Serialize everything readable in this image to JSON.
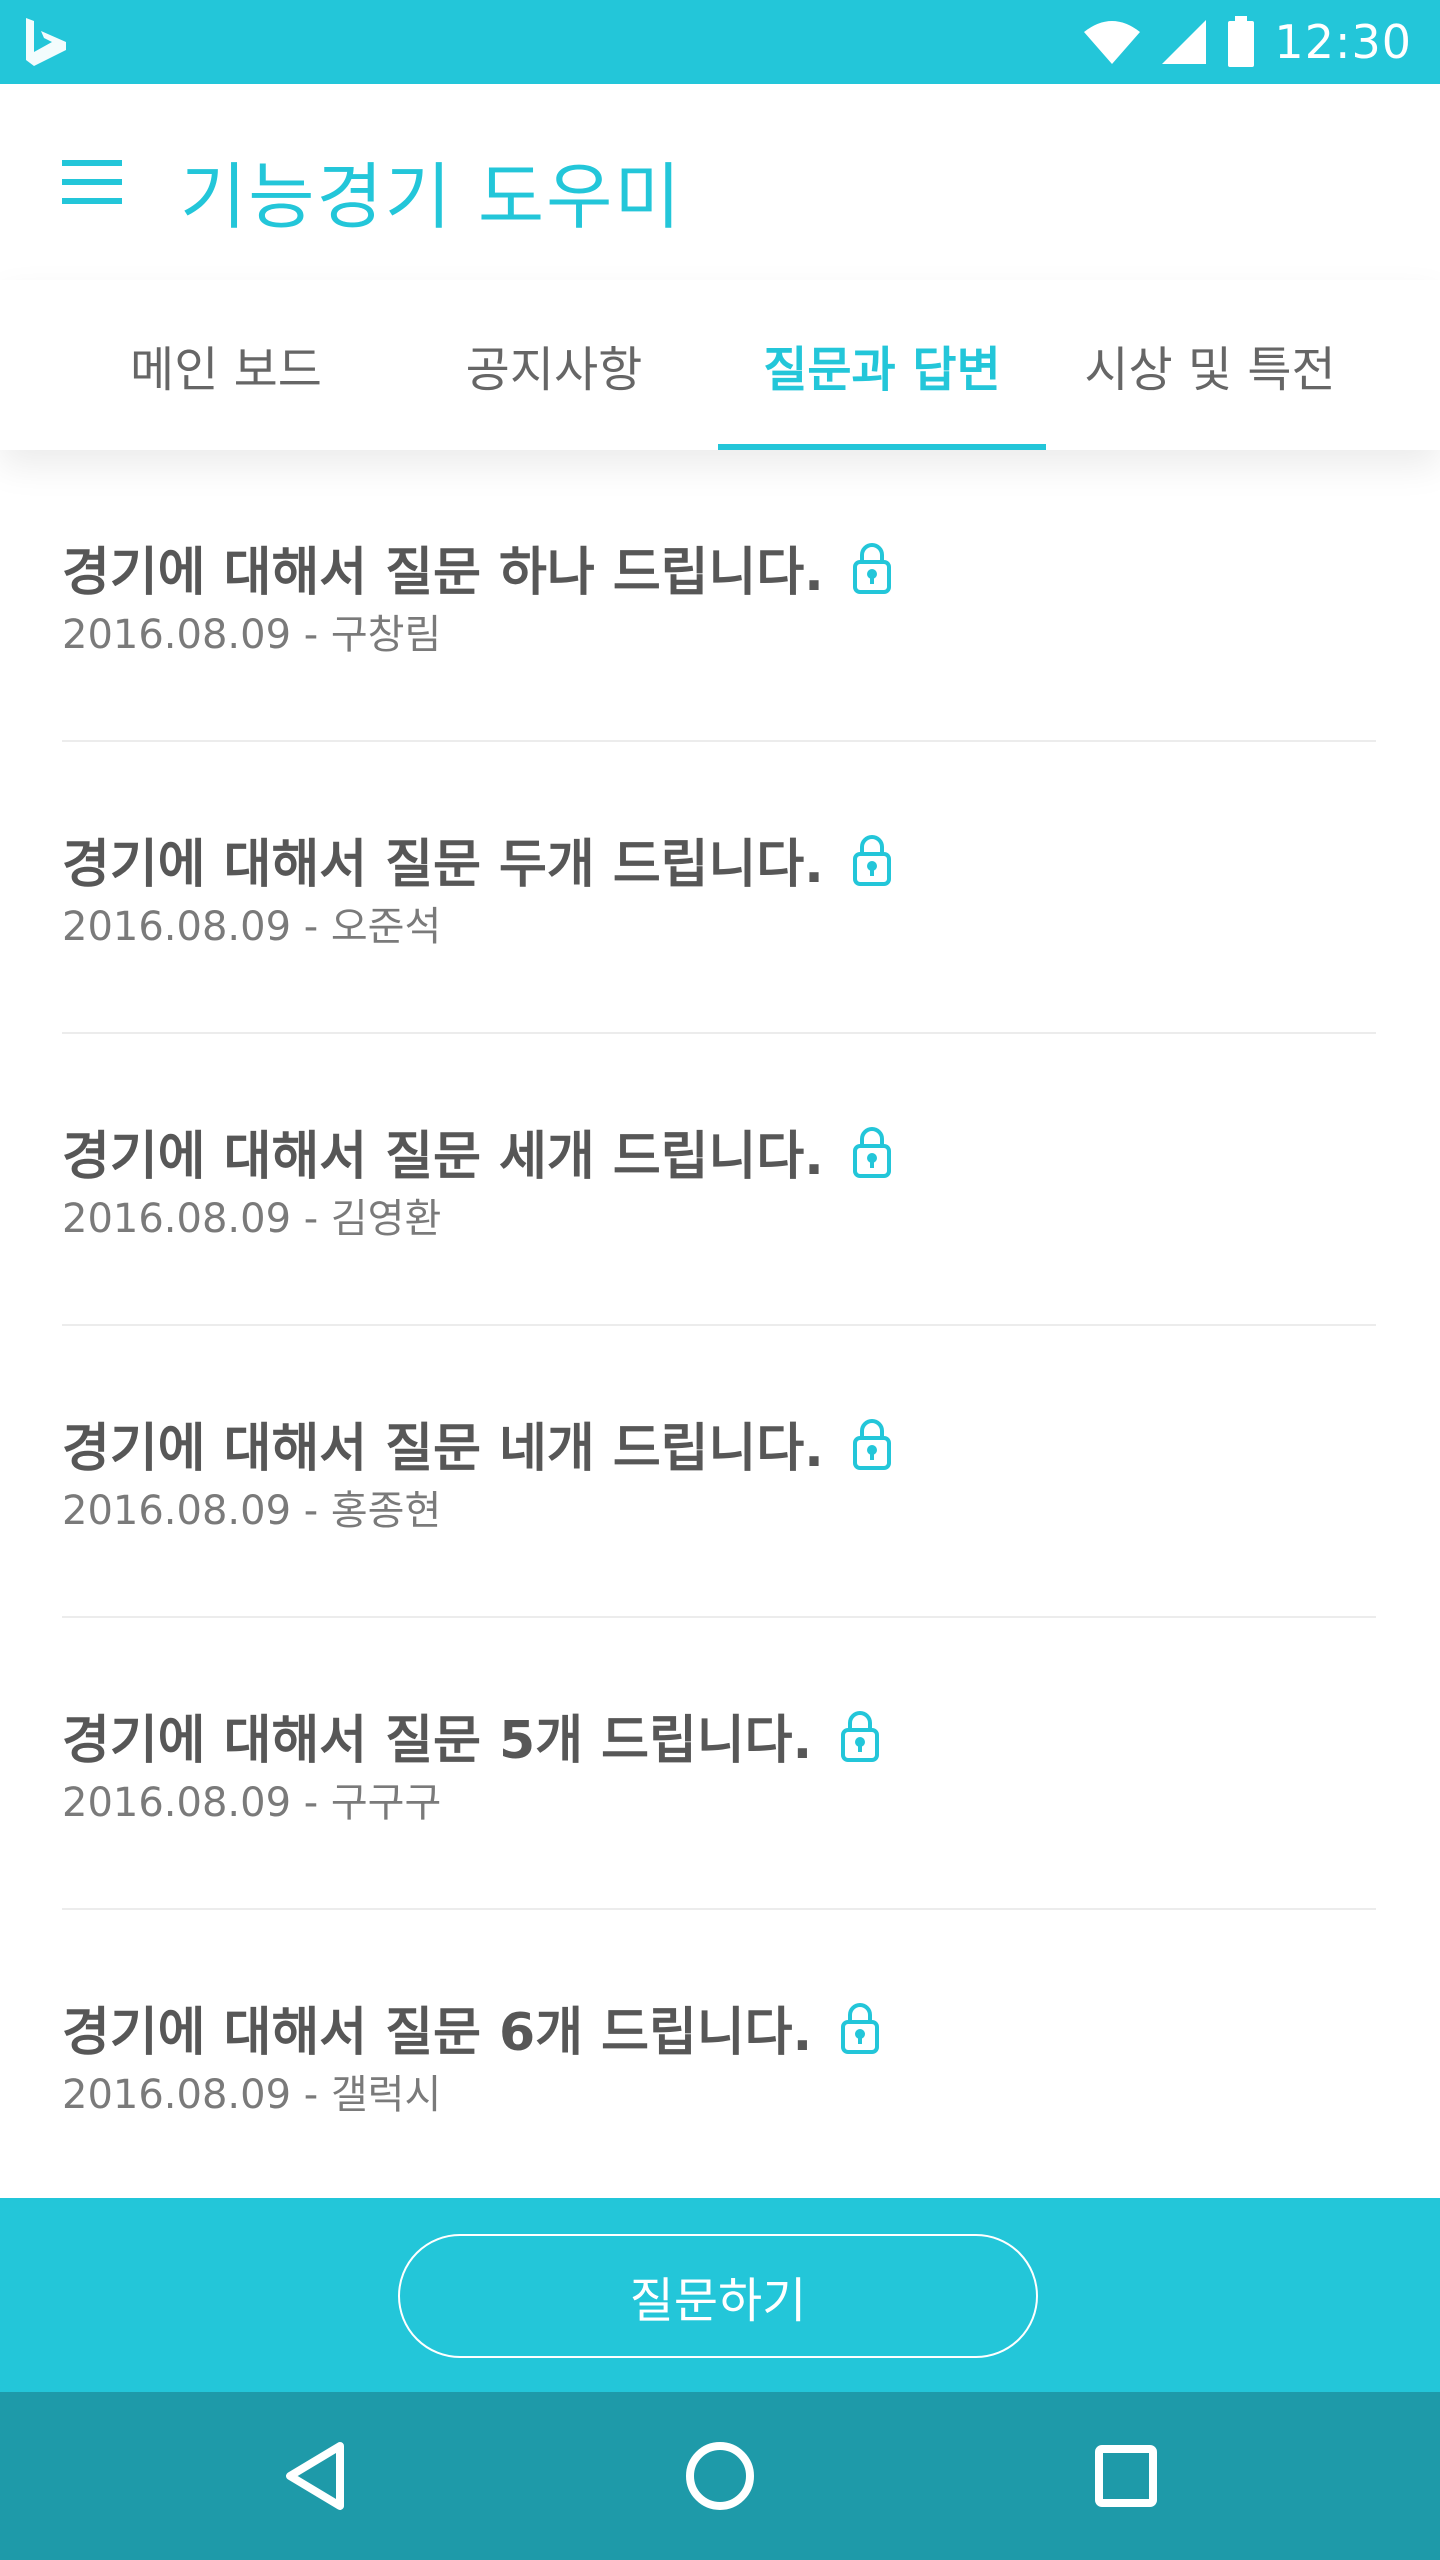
{
  "status_bar": {
    "time": "12:30",
    "icons": [
      "bing-logo-icon",
      "wifi-icon",
      "signal-icon",
      "battery-icon"
    ]
  },
  "app_bar": {
    "title": "기능경기 도우미",
    "menu_icon": "hamburger-menu-icon"
  },
  "tabs": [
    {
      "label": "메인 보드",
      "active": false
    },
    {
      "label": "공지사항",
      "active": false
    },
    {
      "label": "질문과 답변",
      "active": true
    },
    {
      "label": "시상 및 특전",
      "active": false
    }
  ],
  "questions": [
    {
      "title": "경기에 대해서 질문 하나 드립니다.",
      "meta": "2016.08.09 - 구창림",
      "locked": true
    },
    {
      "title": "경기에 대해서 질문 두개 드립니다.",
      "meta": "2016.08.09 - 오준석",
      "locked": true
    },
    {
      "title": "경기에 대해서 질문 세개 드립니다.",
      "meta": "2016.08.09 - 김영환",
      "locked": true
    },
    {
      "title": "경기에 대해서 질문 네개 드립니다.",
      "meta": "2016.08.09 - 홍종현",
      "locked": true
    },
    {
      "title": "경기에 대해서 질문 5개 드립니다.",
      "meta": "2016.08.09 - 구구구",
      "locked": true
    },
    {
      "title": "경기에 대해서 질문 6개 드립니다.",
      "meta": "2016.08.09 - 갤럭시",
      "locked": true
    }
  ],
  "action": {
    "ask_label": "질문하기"
  },
  "nav_bar": {
    "icons": [
      "back-icon",
      "home-icon",
      "recents-icon"
    ]
  },
  "colors": {
    "accent": "#23c6d9",
    "nav": "#1e9aa9",
    "title_text": "#575757",
    "meta_text": "#7a7a7a"
  }
}
